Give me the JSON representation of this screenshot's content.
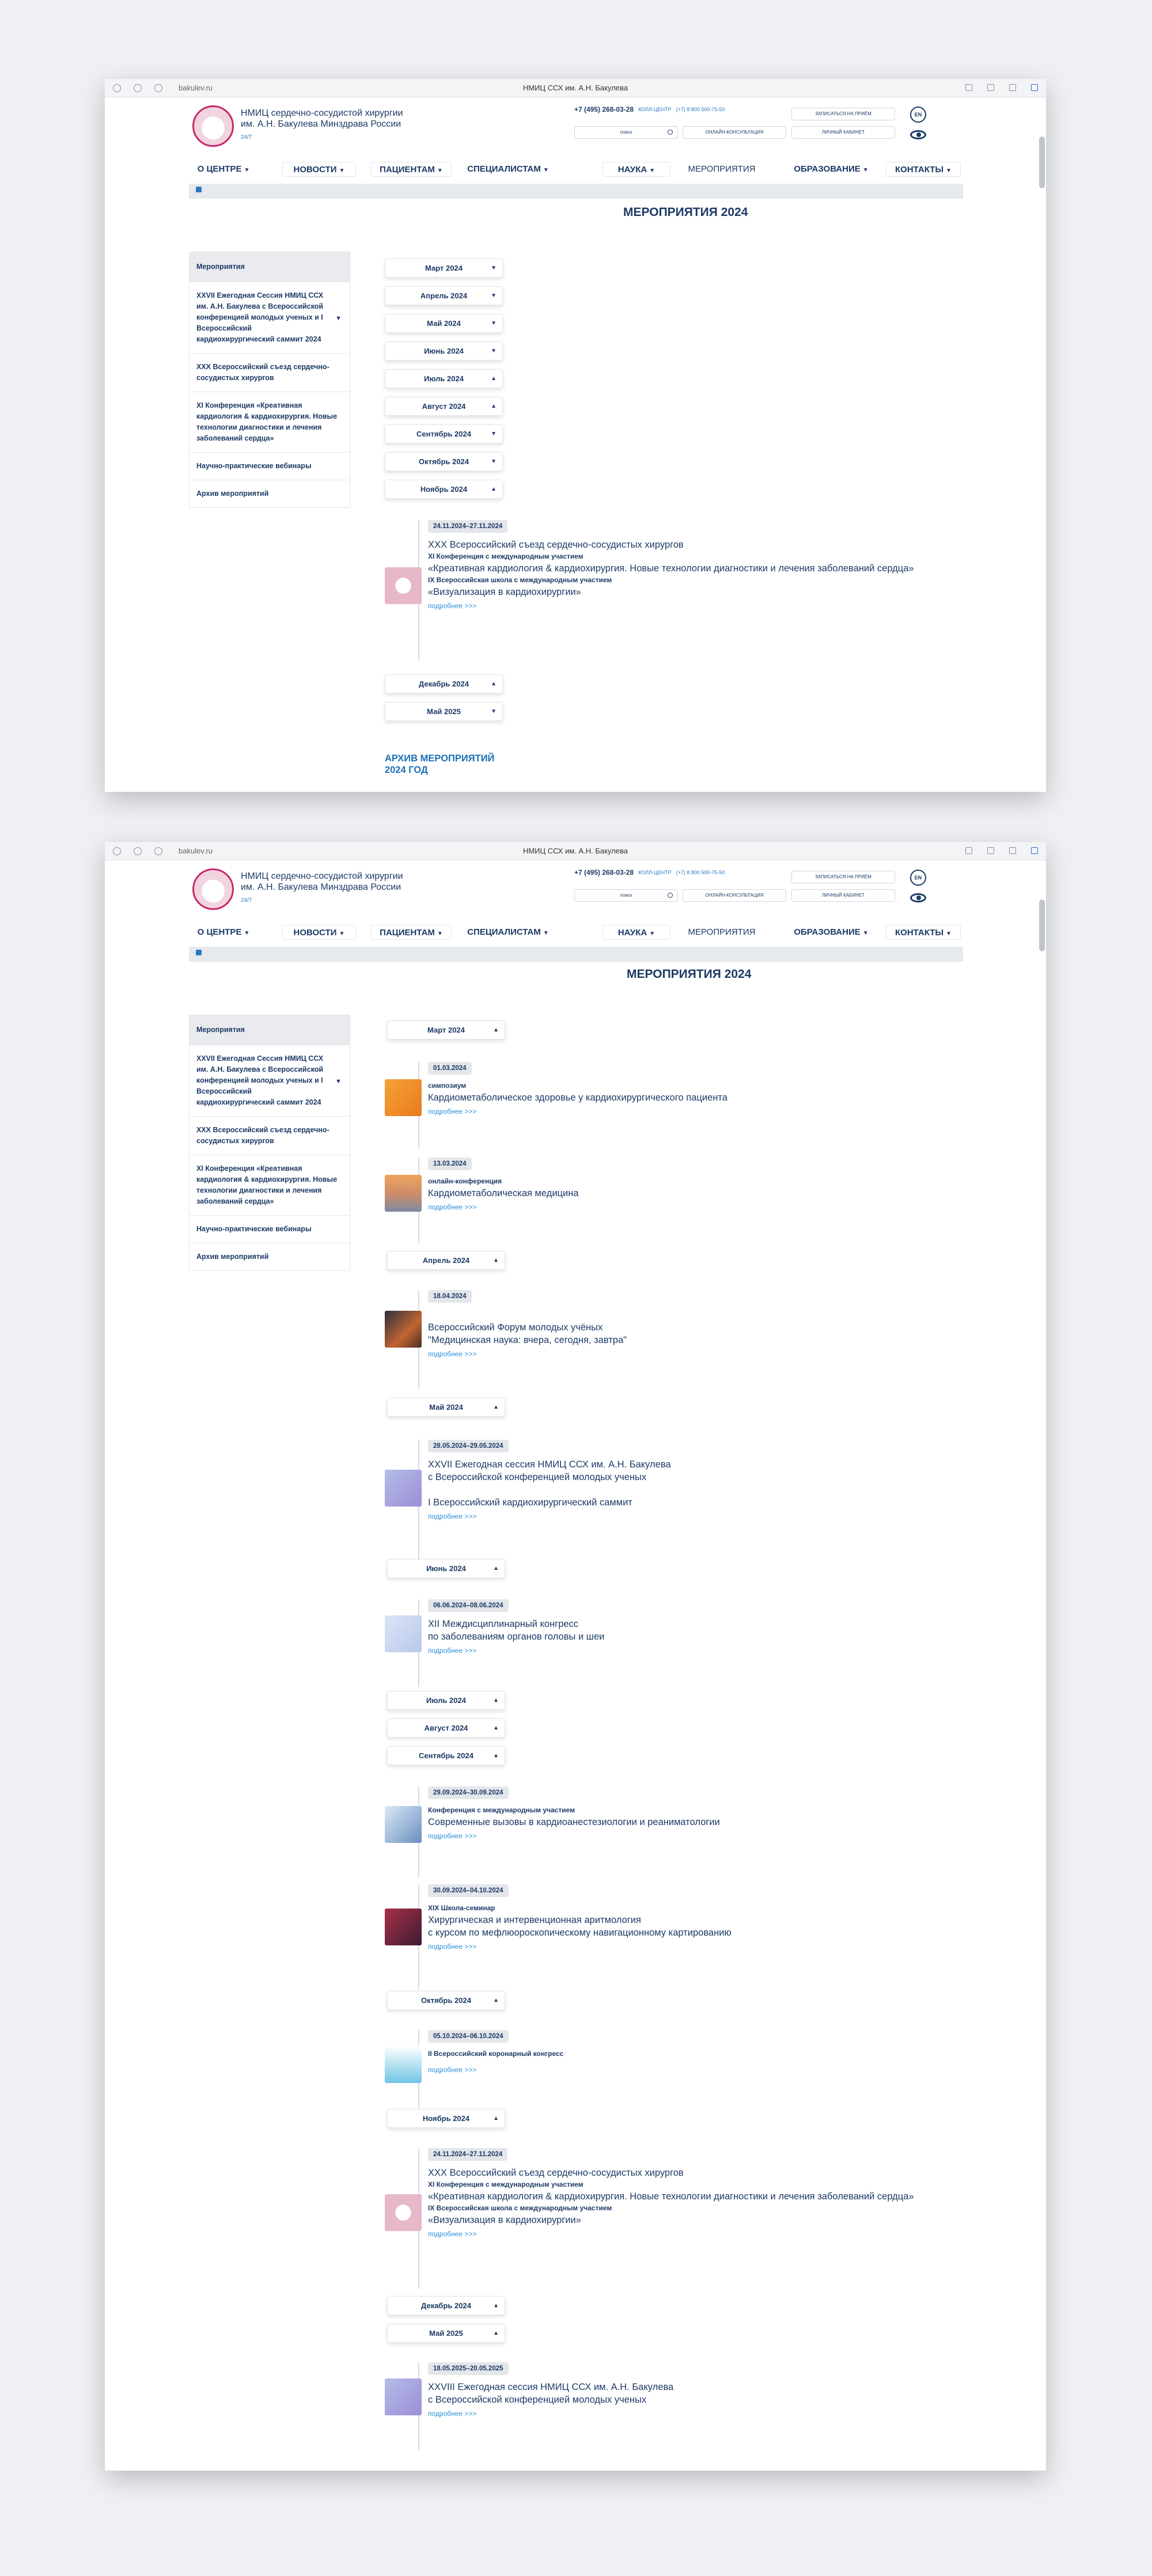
{
  "browser": {
    "url": "bakulev.ru",
    "tab_title": "НМИЦ ССХ им. А.Н. Бакулева"
  },
  "header": {
    "org_line1": "НМИЦ сердечно-сосудистой хирургии",
    "org_line2": "им. А.Н. Бакулева Минздрава России",
    "org_tag": "24/7",
    "phone": "+7 (495) 268-03-28",
    "phone_note": "КОЛЛ-ЦЕНТР",
    "phone2": "(+7) 8 800 500-75-50",
    "search_placeholder": "поиск",
    "appointment": "ЗАПИСАТЬСЯ НА ПРИЁМ",
    "online": "ОНЛАЙН-КОНСУЛЬТАЦИЯ",
    "cabinet": "ЛИЧНЫЙ КАБИНЕТ",
    "lang": "EN"
  },
  "nav": [
    "О ЦЕНТРЕ",
    "НОВОСТИ",
    "ПАЦИЕНТАМ",
    "СПЕЦИАЛИСТАМ",
    "НАУКА",
    "МЕРОПРИЯТИЯ",
    "ОБРАЗОВАНИЕ",
    "КОНТАКТЫ"
  ],
  "page_title": "МЕРОПРИЯТИЯ 2024",
  "sidebar": [
    "Мероприятия",
    "XXVII Ежегодная Сессия НМИЦ ССХ им. А.Н. Бакулева с Всероссийской конференцией молодых ученых и I Всероссийский кардиохирургический саммит 2024",
    "XXX Всероссийский съезд сердечно-сосудистых хирургов",
    "XI Конференция «Креативная кардиология & кардиохирургия. Новые технологии диагностики и лечения заболеваний сердца»",
    "Научно-практические вебинары",
    "Архив мероприятий"
  ],
  "months": [
    "Март 2024",
    "Апрель 2024",
    "Май 2024",
    "Июнь 2024",
    "Июль 2024",
    "Август 2024",
    "Сентябрь 2024",
    "Октябрь 2024",
    "Ноябрь 2024",
    "Декабрь 2024",
    "Май 2025"
  ],
  "more": "подробнее >>>",
  "archive": "АРХИВ МЕРОПРИЯТИЙ\n2024 ГОД",
  "events": {
    "nov": {
      "date": "24.11.2024–27.11.2024",
      "t1": "XXX Всероссийский съезд сердечно-сосудистых хирургов",
      "type1": "XI Конференция с международным участием",
      "t2": "«Креативная кардиология & кардиохирургия. Новые технологии диагностики и лечения заболеваний сердца»",
      "type2": "IX Всероссийская школа с международным участием",
      "t3": "«Визуализация в кардиохирургии»"
    },
    "mar1": {
      "date": "01.03.2024",
      "type": "симпозиум",
      "title": "Кардиометаболическое здоровье у кардиохирургического пациента"
    },
    "mar2": {
      "date": "13.03.2024",
      "type": "онлайн-конференция",
      "title": "Кардиометаболическая медицина"
    },
    "apr": {
      "date": "18.04.2024",
      "title": "Всероссийский Форум молодых учёных\n\"Медицинская наука: вчера, сегодня, завтра\""
    },
    "may": {
      "date": "28.05.2024–29.05.2024",
      "title": "XXVII Ежегодная сессия НМИЦ ССХ им. А.Н. Бакулева\nс Всероссийской конференцией молодых ученых\n\nI Всероссийский кардиохирургический саммит"
    },
    "jun": {
      "date": "06.06.2024–08.06.2024",
      "title": "XII Междисциплинарный конгресс\nпо заболеваниям органов головы и шеи"
    },
    "sep1": {
      "date": "29.09.2024–30.09.2024",
      "type": "Конференция с международным участием",
      "title": "Современные вызовы в кардиоанестезиологии и реаниматологии"
    },
    "sep2": {
      "date": "30.09.2024–04.10.2024",
      "type": "XIX Школа-семинар",
      "title": "Хирургическая и интервенционная аритмология\nс курсом по мефлюороскопическому навигационному картированию"
    },
    "oct": {
      "date": "05.10.2024–06.10.2024",
      "type": "II Всероссийский коронарный конгресс"
    },
    "may25": {
      "date": "18.05.2025–20.05.2025",
      "title": "XXVIII Ежегодная сессия НМИЦ ССХ им. А.Н. Бакулева\nс Всероссийской конференцией молодых ученых"
    }
  }
}
